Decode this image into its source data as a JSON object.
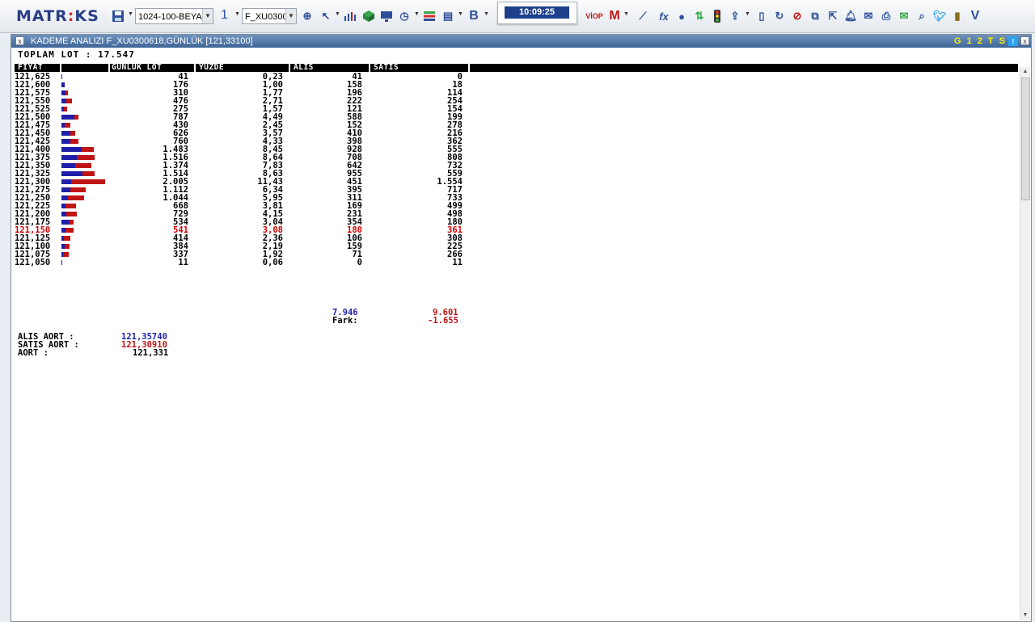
{
  "toolbar": {
    "logo_text": "MATRIKS",
    "layout_select": "1024-100-BEYA",
    "page_num": "1",
    "symbol_select": "F_XU0300",
    "clock": "10:09:25"
  },
  "window": {
    "title": "KADEME ANALIZI F_XU0300618,GÜNLÜK [121,33100]",
    "right_tag": "G 1 2 T S",
    "close_label": "x",
    "toplam_lot": "TOPLAM LOT : 17.547"
  },
  "columns": {
    "fiyat": "FİYAT",
    "gunluk_lot": "GUNLUK LOT",
    "yuzde": "YUZDE",
    "alis": "ALIS",
    "satis": "SATIS"
  },
  "rows": [
    {
      "price": "121,625",
      "lot": "41",
      "pct": "0,23",
      "alis": "41",
      "satis": "0",
      "alis_n": 41,
      "satis_n": 0
    },
    {
      "price": "121,600",
      "lot": "176",
      "pct": "1,00",
      "alis": "158",
      "satis": "18",
      "alis_n": 158,
      "satis_n": 18
    },
    {
      "price": "121,575",
      "lot": "310",
      "pct": "1,77",
      "alis": "196",
      "satis": "114",
      "alis_n": 196,
      "satis_n": 114
    },
    {
      "price": "121,550",
      "lot": "476",
      "pct": "2,71",
      "alis": "222",
      "satis": "254",
      "alis_n": 222,
      "satis_n": 254
    },
    {
      "price": "121,525",
      "lot": "275",
      "pct": "1,57",
      "alis": "121",
      "satis": "154",
      "alis_n": 121,
      "satis_n": 154
    },
    {
      "price": "121,500",
      "lot": "787",
      "pct": "4,49",
      "alis": "588",
      "satis": "199",
      "alis_n": 588,
      "satis_n": 199
    },
    {
      "price": "121,475",
      "lot": "430",
      "pct": "2,45",
      "alis": "152",
      "satis": "278",
      "alis_n": 152,
      "satis_n": 278
    },
    {
      "price": "121,450",
      "lot": "626",
      "pct": "3,57",
      "alis": "410",
      "satis": "216",
      "alis_n": 410,
      "satis_n": 216
    },
    {
      "price": "121,425",
      "lot": "760",
      "pct": "4,33",
      "alis": "398",
      "satis": "362",
      "alis_n": 398,
      "satis_n": 362
    },
    {
      "price": "121,400",
      "lot": "1.483",
      "pct": "8,45",
      "alis": "928",
      "satis": "555",
      "alis_n": 928,
      "satis_n": 555
    },
    {
      "price": "121,375",
      "lot": "1.516",
      "pct": "8,64",
      "alis": "708",
      "satis": "808",
      "alis_n": 708,
      "satis_n": 808
    },
    {
      "price": "121,350",
      "lot": "1.374",
      "pct": "7,83",
      "alis": "642",
      "satis": "732",
      "alis_n": 642,
      "satis_n": 732
    },
    {
      "price": "121,325",
      "lot": "1.514",
      "pct": "8,63",
      "alis": "955",
      "satis": "559",
      "alis_n": 955,
      "satis_n": 559
    },
    {
      "price": "121,300",
      "lot": "2.005",
      "pct": "11,43",
      "alis": "451",
      "satis": "1.554",
      "alis_n": 451,
      "satis_n": 1554
    },
    {
      "price": "121,275",
      "lot": "1.112",
      "pct": "6,34",
      "alis": "395",
      "satis": "717",
      "alis_n": 395,
      "satis_n": 717
    },
    {
      "price": "121,250",
      "lot": "1.044",
      "pct": "5,95",
      "alis": "311",
      "satis": "733",
      "alis_n": 311,
      "satis_n": 733
    },
    {
      "price": "121,225",
      "lot": "668",
      "pct": "3,81",
      "alis": "169",
      "satis": "499",
      "alis_n": 169,
      "satis_n": 499
    },
    {
      "price": "121,200",
      "lot": "729",
      "pct": "4,15",
      "alis": "231",
      "satis": "498",
      "alis_n": 231,
      "satis_n": 498
    },
    {
      "price": "121,175",
      "lot": "534",
      "pct": "3,04",
      "alis": "354",
      "satis": "180",
      "alis_n": 354,
      "satis_n": 180
    },
    {
      "price": "121,150",
      "lot": "541",
      "pct": "3,08",
      "alis": "180",
      "satis": "361",
      "alis_n": 180,
      "satis_n": 361,
      "highlight": true
    },
    {
      "price": "121,125",
      "lot": "414",
      "pct": "2,36",
      "alis": "106",
      "satis": "308",
      "alis_n": 106,
      "satis_n": 308
    },
    {
      "price": "121,100",
      "lot": "384",
      "pct": "2,19",
      "alis": "159",
      "satis": "225",
      "alis_n": 159,
      "satis_n": 225
    },
    {
      "price": "121,075",
      "lot": "337",
      "pct": "1,92",
      "alis": "71",
      "satis": "266",
      "alis_n": 71,
      "satis_n": 266
    },
    {
      "price": "121,050",
      "lot": "11",
      "pct": "0,06",
      "alis": "0",
      "satis": "11",
      "alis_n": 0,
      "satis_n": 11
    }
  ],
  "totals": {
    "alis_total": "7.946",
    "satis_total": "9.601",
    "fark_label": "Fark:",
    "fark_value": "-1.655"
  },
  "averages": {
    "alis_label": "ALIS AORT :",
    "alis_value": "121,35740",
    "satis_label": "SATIS AORT :",
    "satis_value": "121,30910",
    "aort_label": "AORT :",
    "aort_value": "121,331"
  },
  "colors": {
    "buy": "#1f1fa8",
    "sell": "#c01414",
    "highlight": "#d00000",
    "title_bar": "#4e74a6"
  },
  "icons": [
    "save-icon",
    "chart-icon",
    "cube-icon",
    "monitor-icon",
    "clock-icon",
    "list-icon",
    "bold-icon",
    "viop-icon",
    "line-chart-icon",
    "formula-icon",
    "user-icon",
    "transfer-icon",
    "traffic-light-icon",
    "upload-icon",
    "document-icon",
    "refresh-icon",
    "pin-icon",
    "window-icon",
    "bell-icon",
    "mail-icon",
    "print-icon",
    "chat-icon",
    "zoom-icon",
    "twitter-icon",
    "book-icon",
    "v-icon"
  ]
}
